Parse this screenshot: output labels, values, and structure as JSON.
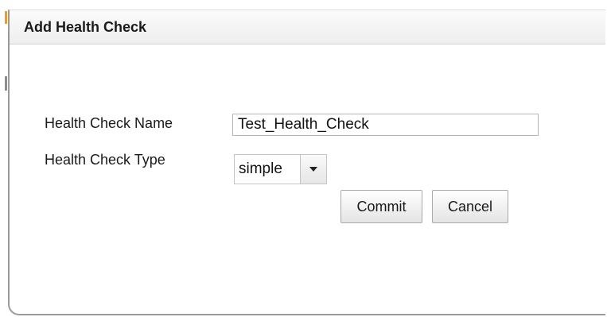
{
  "dialog": {
    "title": "Add Health Check"
  },
  "form": {
    "name_label": "Health Check Name",
    "name_value": "Test_Health_Check",
    "type_label": "Health Check Type",
    "type_value": "simple"
  },
  "buttons": {
    "commit_label": "Commit",
    "cancel_label": "Cancel"
  },
  "icons": {
    "dropdown": "triangle-down-icon"
  },
  "colors": {
    "header_bg": "#eeeeee",
    "border": "#9a9a9a",
    "accent_mark": "#d9a04a"
  }
}
